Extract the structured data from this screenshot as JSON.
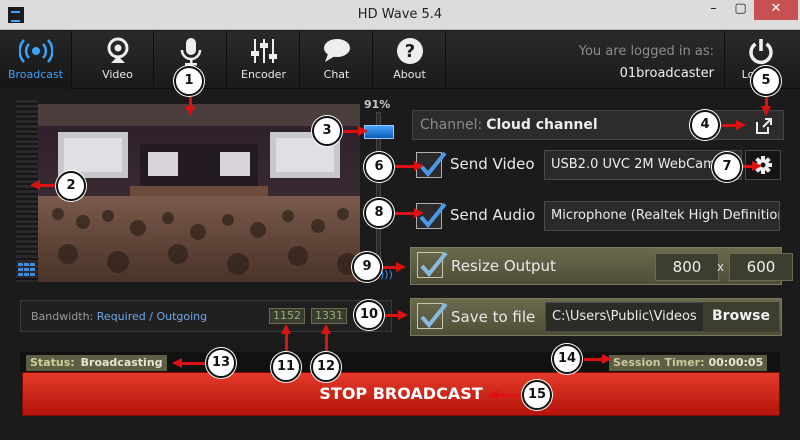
{
  "window": {
    "title": "HD Wave 5.4"
  },
  "toolbar": {
    "items": [
      {
        "label": "Broadcast",
        "icon": "broadcast-icon",
        "active": true
      },
      {
        "label": "Video",
        "icon": "webcam-icon"
      },
      {
        "label": "",
        "icon": "microphone-icon"
      },
      {
        "label": "Encoder",
        "icon": "sliders-icon"
      },
      {
        "label": "Chat",
        "icon": "chat-bubble-icon"
      },
      {
        "label": "About",
        "icon": "question-icon"
      }
    ],
    "login_label": "You are logged in as:",
    "username": "01broadcaster",
    "logout_label": "Logout",
    "logout_icon": "power-icon"
  },
  "preview": {
    "volume_percent": "91%",
    "volume_level": 0.91
  },
  "channel": {
    "label": "Channel:",
    "name": "Cloud channel",
    "icon": "external-link-icon"
  },
  "send_video": {
    "label": "Send Video",
    "checked": true,
    "device": "USB2.0 UVC 2M WebCam",
    "settings_icon": "gear-icon"
  },
  "send_audio": {
    "label": "Send Audio",
    "checked": true,
    "device": "Microphone (Realtek High Definition Audio)"
  },
  "resize_output": {
    "label": "Resize Output",
    "checked": true,
    "width": "800",
    "separator": "x",
    "height": "600"
  },
  "save_to_file": {
    "label": "Save to file",
    "checked": true,
    "path": "C:\\Users\\Public\\Videos",
    "browse_label": "Browse"
  },
  "bandwidth": {
    "label": "Bandwidth:",
    "required_label": "Required",
    "slash": "/",
    "outgoing_label": "Outgoing",
    "required_value": "1152",
    "outgoing_value": "1331"
  },
  "status": {
    "label": "Status:",
    "value": "Broadcasting"
  },
  "timer": {
    "label": "Session Timer:",
    "value": "00:00:05"
  },
  "stop_button": {
    "label": "STOP BROADCAST"
  },
  "callouts": [
    "1",
    "2",
    "3",
    "4",
    "5",
    "6",
    "7",
    "8",
    "9",
    "10",
    "11",
    "12",
    "13",
    "14",
    "15"
  ],
  "colors": {
    "accent": "#3aa2ff",
    "stop_red": "#d2281a",
    "olive": "#5e5e45",
    "callout_arrow": "#dd1111"
  }
}
